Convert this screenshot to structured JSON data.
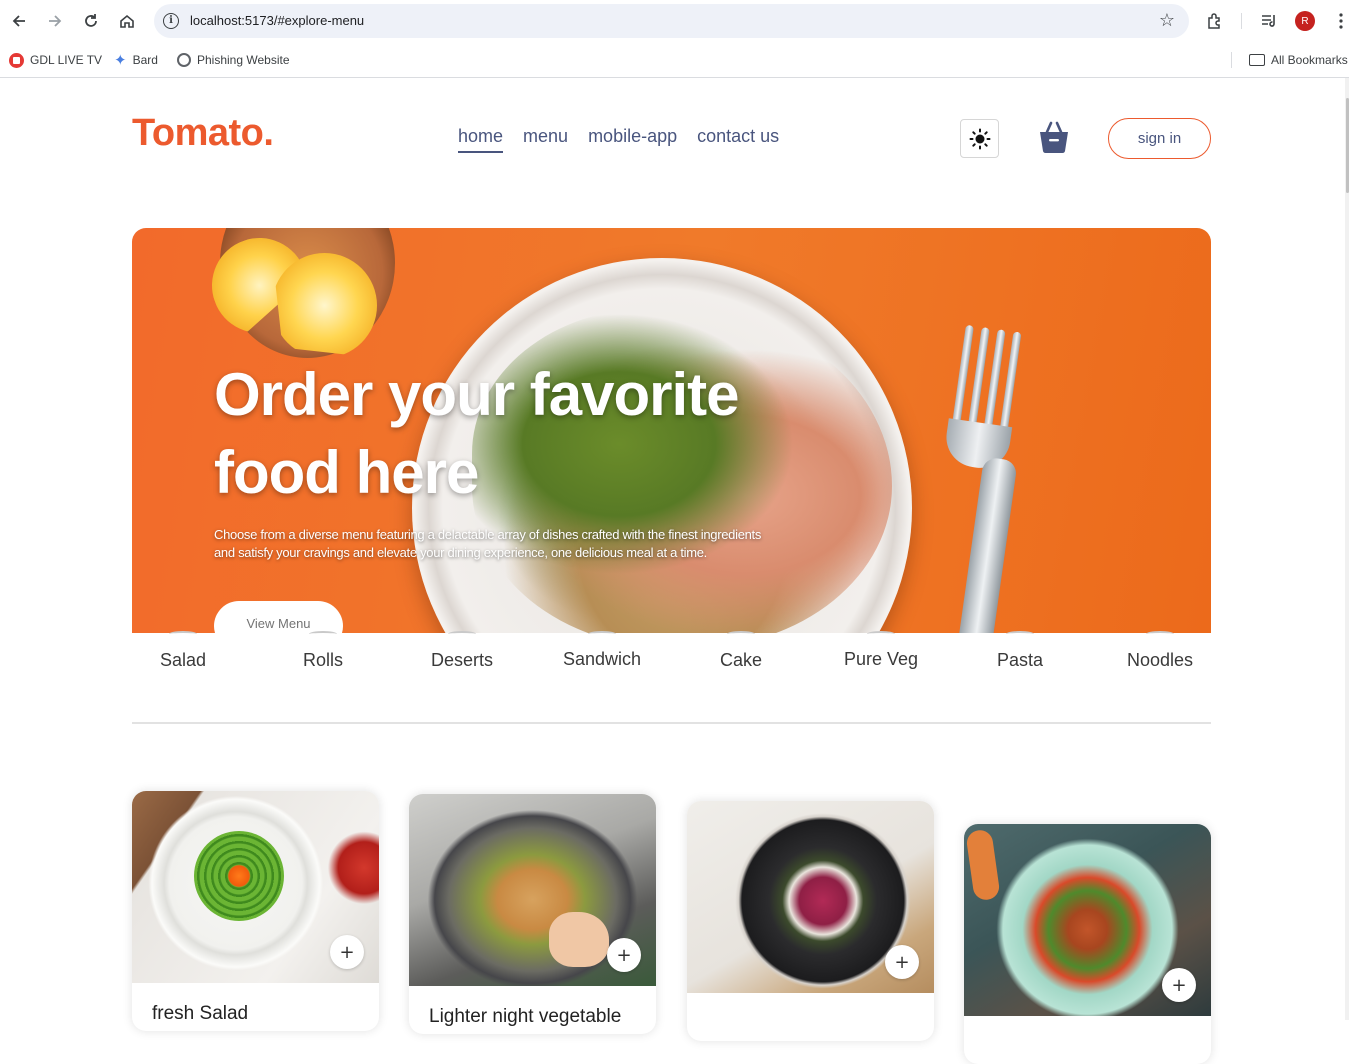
{
  "browser": {
    "url": "localhost:5173/#explore-menu",
    "avatar_letter": "R",
    "bookmarks": [
      "GDL LIVE TV",
      "Bard",
      "Phishing Website"
    ],
    "all_bookmarks": "All Bookmarks"
  },
  "site": {
    "logo": "Tomato.",
    "nav": [
      "home",
      "menu",
      "mobile-app",
      "contact us"
    ],
    "active_nav": "home",
    "sign_in": "sign in",
    "accent_color": "#ec5a2e",
    "nav_color": "#49557e"
  },
  "hero": {
    "title_line1": "Order your favorite",
    "title_line2": "food here",
    "description": "Choose from a diverse menu featuring a delactable array of dishes crafted with the finest ingredients and satisfy your cravings and elevate your dining experience, one delicious meal at a time.",
    "button": "View Menu"
  },
  "categories": [
    "Salad",
    "Rolls",
    "Deserts",
    "Sandwich",
    "Cake",
    "Pure Veg",
    "Pasta",
    "Noodles"
  ],
  "foods": [
    {
      "name": "fresh Salad",
      "add_icon": "+"
    },
    {
      "name": "Lighter night vegetable",
      "add_icon": "+"
    },
    {
      "name": "",
      "add_icon": "+"
    },
    {
      "name": "",
      "add_icon": "+"
    }
  ]
}
